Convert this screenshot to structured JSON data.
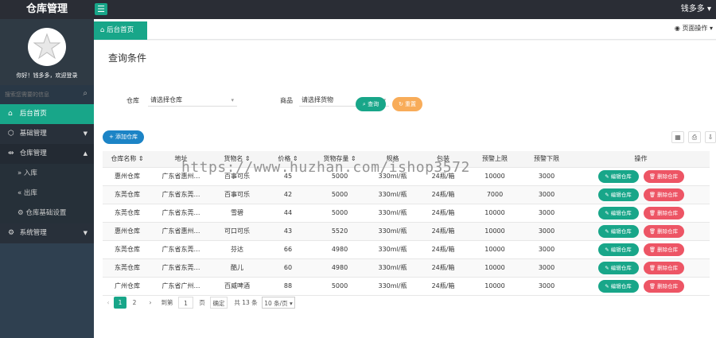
{
  "app": {
    "title": "仓库管理",
    "menu_icon": "☰",
    "user": "钱多多"
  },
  "sidebar": {
    "greeting": "你好！钱多多，欢迎登录",
    "search_placeholder": "搜索您需要的信息",
    "items": [
      {
        "label": "后台首页",
        "icon": "home-icon"
      },
      {
        "label": "基础管理",
        "icon": "cube-icon"
      },
      {
        "label": "仓库管理",
        "icon": "arrows-icon"
      },
      {
        "label": "入库",
        "icon": "chevron-right-icon"
      },
      {
        "label": "出库",
        "icon": "chevron-left-icon"
      },
      {
        "label": "仓库基础设置",
        "icon": "gear-icon"
      },
      {
        "label": "系统管理",
        "icon": "gear-icon"
      }
    ]
  },
  "tabs": {
    "home": "后台首页",
    "page_ops": "页面操作"
  },
  "query": {
    "title": "查询条件",
    "warehouse_label": "仓库",
    "warehouse_value": "请选择仓库",
    "goods_label": "商品",
    "goods_value": "请选择货物",
    "search_btn": "查询",
    "reset_btn": "重置"
  },
  "table": {
    "add_btn": "添加仓库",
    "columns": [
      "仓库名称",
      "地址",
      "货物名",
      "价格",
      "货物存量",
      "规格",
      "包装",
      "预警上限",
      "预警下限",
      "操作"
    ],
    "rows": [
      [
        "惠州仓库",
        "广东省惠州…",
        "百事可乐",
        "45",
        "5000",
        "330ml/瓶",
        "24瓶/箱",
        "10000",
        "3000"
      ],
      [
        "东莞仓库",
        "广东省东莞…",
        "百事可乐",
        "42",
        "5000",
        "330ml/瓶",
        "24瓶/箱",
        "7000",
        "3000"
      ],
      [
        "东莞仓库",
        "广东省东莞…",
        "雪碧",
        "44",
        "5000",
        "330ml/瓶",
        "24瓶/箱",
        "10000",
        "3000"
      ],
      [
        "惠州仓库",
        "广东省惠州…",
        "可口可乐",
        "43",
        "5520",
        "330ml/瓶",
        "24瓶/箱",
        "10000",
        "3000"
      ],
      [
        "东莞仓库",
        "广东省东莞…",
        "芬达",
        "66",
        "4980",
        "330ml/瓶",
        "24瓶/箱",
        "10000",
        "3000"
      ],
      [
        "东莞仓库",
        "广东省东莞…",
        "酷儿",
        "60",
        "4980",
        "330ml/瓶",
        "24瓶/箱",
        "10000",
        "3000"
      ],
      [
        "广州仓库",
        "广东省广州…",
        "百威啤酒",
        "88",
        "5000",
        "330ml/瓶",
        "24瓶/箱",
        "10000",
        "3000"
      ]
    ],
    "edit_btn": "编辑仓库",
    "delete_btn": "删除仓库"
  },
  "pager": {
    "prev": "‹",
    "page1": "1",
    "page2": "2",
    "next": "›",
    "goto_label": "到第",
    "goto_value": "1",
    "page_unit": "页",
    "confirm": "确定",
    "total": "共 13 条",
    "page_size": "10 条/页"
  },
  "watermark": "https://www.huzhan.com/ishop3572",
  "colors": {
    "primary": "#18a689",
    "danger": "#ed5565",
    "warning": "#f8ac59",
    "info": "#1c84c6",
    "sidebar": "#2f4050"
  }
}
